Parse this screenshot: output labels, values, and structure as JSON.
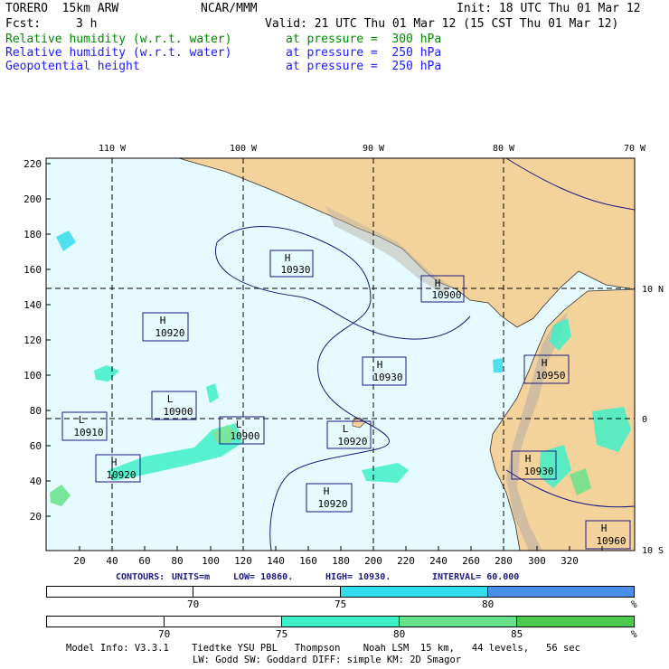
{
  "header": {
    "model": "TORERO  15km ARW",
    "org": "NCAR/MMM",
    "init": "Init: 18 UTC Thu 01 Mar 12",
    "fcst_label": "Fcst:",
    "fcst_value": "3 h",
    "valid": "Valid: 21 UTC Thu 01 Mar 12 (15 CST Thu 01 Mar 12)",
    "fields": [
      {
        "name": "Relative humidity (w.r.t. water)",
        "level": "at pressure =  300 hPa",
        "color": "#008800"
      },
      {
        "name": "Relative humidity (w.r.t. water)",
        "level": "at pressure =  250 hPa",
        "color": "#1a1aff"
      },
      {
        "name": "Geopotential height",
        "level": "at pressure =  250 hPa",
        "color": "#1a1aff"
      }
    ]
  },
  "map": {
    "ocean_color": "#e6fbff",
    "land_color": "#f4d29c",
    "lon_labels": [
      "110 W",
      "100 W",
      "90 W",
      "80 W",
      "70 W"
    ],
    "lat_labels": [
      "10 N",
      "0",
      "10 S"
    ],
    "x_ticks": [
      "20",
      "40",
      "60",
      "80",
      "100",
      "120",
      "140",
      "160",
      "180",
      "200",
      "220",
      "240",
      "260",
      "280",
      "300",
      "320"
    ],
    "y_ticks": [
      "220",
      "200",
      "180",
      "160",
      "140",
      "120",
      "100",
      "80",
      "60",
      "40",
      "20"
    ],
    "pressure_centers": [
      {
        "type": "H",
        "value": "10930"
      },
      {
        "type": "H",
        "value": "10900"
      },
      {
        "type": "H",
        "value": "10920"
      },
      {
        "type": "L",
        "value": "10900"
      },
      {
        "type": "H",
        "value": "10930"
      },
      {
        "type": "H",
        "value": "10950"
      },
      {
        "type": "L",
        "value": "10910"
      },
      {
        "type": "L",
        "value": "10900"
      },
      {
        "type": "L",
        "value": "10920"
      },
      {
        "type": "H",
        "value": "10920"
      },
      {
        "type": "H",
        "value": "10930"
      },
      {
        "type": "H",
        "value": "10920"
      },
      {
        "type": "H",
        "value": "10960"
      }
    ]
  },
  "contours_line": {
    "label": "CONTOURS:",
    "units": "UNITS=m",
    "low": "LOW=  10860.",
    "high": "HIGH=  10930.",
    "interval": "INTERVAL=   60.000"
  },
  "colorbar_250": {
    "labels": [
      "70",
      "75",
      "80",
      "%"
    ],
    "colors": [
      "#ffffff",
      "#ffffff",
      "#33ddee",
      "#4a8fe8"
    ]
  },
  "colorbar_300": {
    "labels": [
      "70",
      "75",
      "80",
      "85",
      "%"
    ],
    "colors": [
      "#ffffff",
      "#ffffff",
      "#3ef0c8",
      "#66e38a",
      "#4cc84c"
    ]
  },
  "footer": {
    "line1": "Model Info: V3.3.1    Tiedtke YSU PBL   Thompson    Noah LSM  15 km,   44 levels,   56 sec",
    "line2": "LW: Godd SW: Goddard DIFF: simple KM: 2D Smagor"
  }
}
